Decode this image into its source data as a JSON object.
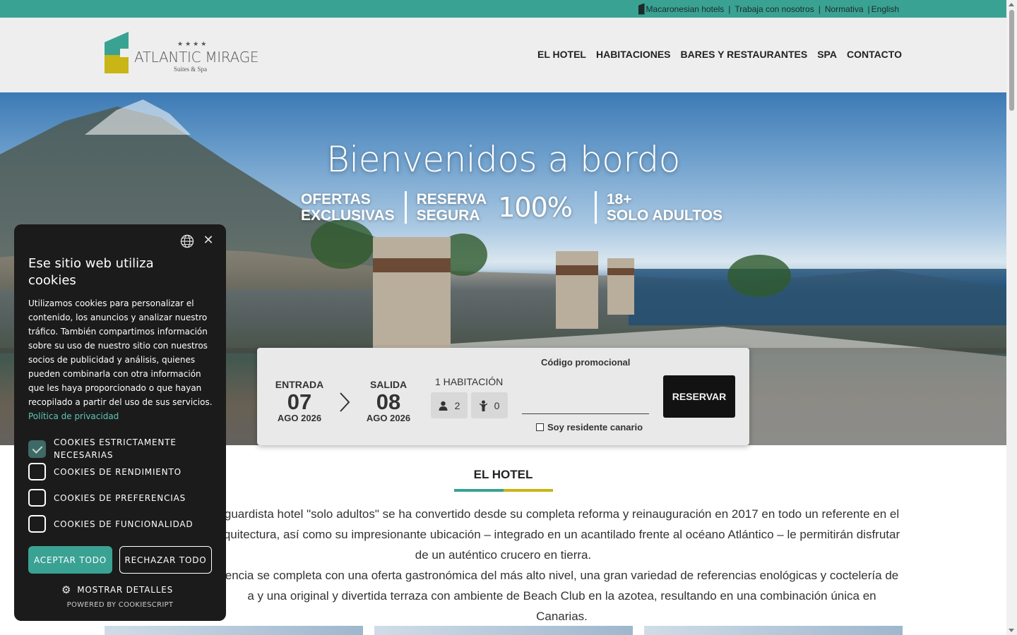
{
  "topbar": {
    "links": [
      "Macaronesian hotels",
      "Trabaja con nosotros",
      "Normativa",
      "English"
    ],
    "icon": "macaronesian-logo-icon"
  },
  "logo": {
    "stars": "★★★★",
    "name": "ATLANTIC MIRAGE",
    "subtitle": "Suites & Spa"
  },
  "nav": {
    "items": [
      "EL HOTEL",
      "HABITACIONES",
      "BARES Y RESTAURANTES",
      "SPA",
      "CONTACTO"
    ]
  },
  "hero": {
    "title": "Bienvenidos a bordo",
    "badge1": [
      "OFERTAS",
      "EXCLUSIVAS"
    ],
    "badge2": [
      "RESERVA",
      "SEGURA"
    ],
    "badge2_big": "100%",
    "badge3": [
      "18+",
      "SOLO ADULTOS"
    ]
  },
  "booking": {
    "checkin_label": "ENTRADA",
    "checkin_day": "07",
    "checkin_month": "AGO 2026",
    "checkout_label": "SALIDA",
    "checkout_day": "08",
    "checkout_month": "AGO 2026",
    "rooms_label": "1 HABITACIÓN",
    "adults": "2",
    "children": "0",
    "promo_label": "Código promocional",
    "promo_value": "",
    "resident_label": "Soy residente canario",
    "reserve_label": "RESERVAR"
  },
  "hotel": {
    "title": "EL HOTEL",
    "p1_visible": "guardista hotel \"solo adultos\" se ha convertido desde su completa reforma y reinauguración en 2017 en todo un referente en el",
    "p1_line2": "quitectura, así como su impresionante ubicación – integrado en un acantilado frente al océano Atlántico – le permitirán disfrutar",
    "p1_line3": "de un auténtico crucero en tierra.",
    "p2_line1": "encia se completa con una oferta gastronómica del más alto nivel, una gran variedad de referencias enológicas y coctelería de",
    "p2_line2": "a y una original y divertida terraza con ambiente de Beach Club en la azotea, resultando en una combinación única en Canarias."
  },
  "cookie": {
    "title": "Ese sitio web utiliza cookies",
    "text": "Utilizamos cookies para personalizar el contenido, los anuncios y analizar nuestro tráfico. También compartimos información sobre su uso de nuestro sitio con nuestros socios de publicidad y análisis, quienes pueden combinarla con otra información que les haya proporcionado o que hayan recopilado a partir del uso de sus servicios.",
    "privacy_link": "Política de privacidad",
    "options": [
      {
        "label": "COOKIES ESTRICTAMENTE NECESARIAS",
        "checked": true
      },
      {
        "label": "COOKIES DE RENDIMIENTO",
        "checked": false
      },
      {
        "label": "COOKIES DE PREFERENCIAS",
        "checked": false
      },
      {
        "label": "COOKIES DE FUNCIONALIDAD",
        "checked": false
      }
    ],
    "accept_label": "ACEPTAR TODO",
    "reject_label": "RECHAZAR TODO",
    "details_label": "MOSTRAR DETALLES",
    "powered_label": "POWERED BY COOKIESCRIPT"
  },
  "colors": {
    "accent_green": "#3aa293",
    "accent_yellow": "#c9b516",
    "cookie_bg": "#1b1b1b",
    "button_dark": "#121212"
  }
}
